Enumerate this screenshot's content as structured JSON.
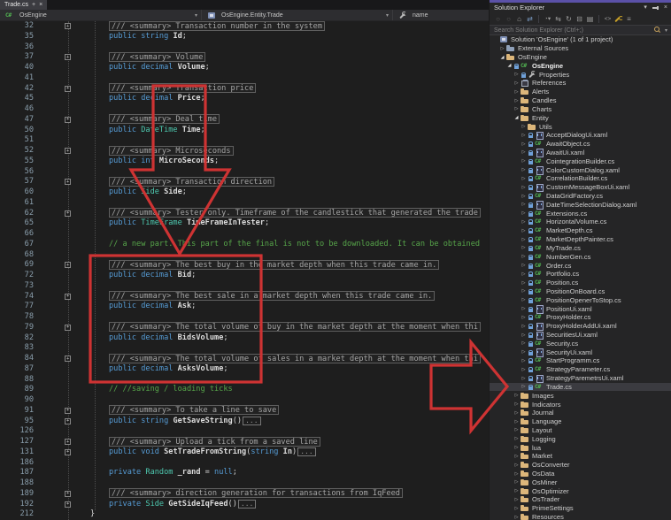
{
  "editor": {
    "tab": {
      "title": "Trade.cs"
    },
    "breadcrumb": {
      "project": "OsEngine",
      "type": "OsEngine.Entity.Trade",
      "member": "name"
    },
    "code_lines": [
      {
        "n": "32",
        "fold": 1,
        "sum": "/// <summary> Transaction number in the system"
      },
      {
        "n": "35",
        "parts": [
          [
            "public ",
            "k"
          ],
          [
            "string ",
            "k"
          ],
          [
            "Id",
            "id"
          ],
          [
            ";",
            "pl"
          ]
        ]
      },
      {
        "n": "36"
      },
      {
        "n": "37",
        "fold": 1,
        "sum": "/// <summary> Volume"
      },
      {
        "n": "40",
        "parts": [
          [
            "public ",
            "k"
          ],
          [
            "decimal ",
            "k"
          ],
          [
            "Volume",
            "id"
          ],
          [
            ";",
            "pl"
          ]
        ]
      },
      {
        "n": "41"
      },
      {
        "n": "42",
        "fold": 1,
        "sum": "/// <summary> Transaction price"
      },
      {
        "n": "45",
        "parts": [
          [
            "public ",
            "k"
          ],
          [
            "decimal ",
            "k"
          ],
          [
            "Price",
            "id"
          ],
          [
            ";",
            "pl"
          ]
        ]
      },
      {
        "n": "46"
      },
      {
        "n": "47",
        "fold": 1,
        "sum": "/// <summary> Deal time"
      },
      {
        "n": "50",
        "parts": [
          [
            "public ",
            "k"
          ],
          [
            "DateTime ",
            "t"
          ],
          [
            "Time",
            "id"
          ],
          [
            ";",
            "pl"
          ]
        ]
      },
      {
        "n": "51"
      },
      {
        "n": "52",
        "fold": 1,
        "sum": "/// <summary> Microseconds"
      },
      {
        "n": "55",
        "parts": [
          [
            "public ",
            "k"
          ],
          [
            "int ",
            "k"
          ],
          [
            "MicroSeconds",
            "id"
          ],
          [
            ";",
            "pl"
          ]
        ]
      },
      {
        "n": "56"
      },
      {
        "n": "57",
        "fold": 1,
        "sum": "/// <summary> Transaction direction"
      },
      {
        "n": "60",
        "parts": [
          [
            "public ",
            "k"
          ],
          [
            "Side ",
            "t"
          ],
          [
            "Side",
            "id"
          ],
          [
            ";",
            "pl"
          ]
        ]
      },
      {
        "n": "61"
      },
      {
        "n": "62",
        "fold": 1,
        "sum": "/// <summary> Tester only. Timeframe of the candlestick that generated the trade"
      },
      {
        "n": "65",
        "parts": [
          [
            "public ",
            "k"
          ],
          [
            "TimeFrame ",
            "t"
          ],
          [
            "TimeFrameInTester",
            "id"
          ],
          [
            ";",
            "pl"
          ]
        ]
      },
      {
        "n": "66"
      },
      {
        "n": "67",
        "parts": [
          [
            "// a new part. This part of the final is not to be downloaded. It can be obtained",
            "cm"
          ]
        ]
      },
      {
        "n": "68"
      },
      {
        "n": "69",
        "fold": 1,
        "sum": "/// <summary> The best buy in the market depth when this trade came in."
      },
      {
        "n": "72",
        "parts": [
          [
            "public ",
            "k"
          ],
          [
            "decimal ",
            "k"
          ],
          [
            "Bid",
            "id"
          ],
          [
            ";",
            "pl"
          ]
        ]
      },
      {
        "n": "73"
      },
      {
        "n": "74",
        "fold": 1,
        "sum": "/// <summary> The best sale in a market depth when this trade came in."
      },
      {
        "n": "77",
        "parts": [
          [
            "public ",
            "k"
          ],
          [
            "decimal ",
            "k"
          ],
          [
            "Ask",
            "id"
          ],
          [
            ";",
            "pl"
          ]
        ]
      },
      {
        "n": "78"
      },
      {
        "n": "79",
        "fold": 1,
        "sum": "/// <summary> The total volume of buy in the market depth at the moment when thi"
      },
      {
        "n": "82",
        "parts": [
          [
            "public ",
            "k"
          ],
          [
            "decimal ",
            "k"
          ],
          [
            "BidsVolume",
            "id"
          ],
          [
            ";",
            "pl"
          ]
        ]
      },
      {
        "n": "83"
      },
      {
        "n": "84",
        "fold": 1,
        "sum": "/// <summary> The total volume of sales in a market depth at the moment when thi"
      },
      {
        "n": "87",
        "parts": [
          [
            "public ",
            "k"
          ],
          [
            "decimal ",
            "k"
          ],
          [
            "AsksVolume",
            "id"
          ],
          [
            ";",
            "pl"
          ]
        ]
      },
      {
        "n": "88"
      },
      {
        "n": "89",
        "parts": [
          [
            "// //saving / loading ticks",
            "cm"
          ]
        ]
      },
      {
        "n": "90"
      },
      {
        "n": "91",
        "fold": 1,
        "sum": "/// <summary> To take a line to save"
      },
      {
        "n": "95",
        "fold": 1,
        "parts": [
          [
            "public ",
            "k"
          ],
          [
            "string ",
            "k"
          ],
          [
            "GetSaveString",
            "id"
          ],
          [
            "()",
            "pl"
          ],
          [
            "...",
            "ell"
          ]
        ]
      },
      {
        "n": "126"
      },
      {
        "n": "127",
        "fold": 1,
        "sum": "/// <summary> Upload a tick from a saved line"
      },
      {
        "n": "131",
        "fold": 1,
        "parts": [
          [
            "public ",
            "k"
          ],
          [
            "void ",
            "k"
          ],
          [
            "SetTradeFromString",
            "id"
          ],
          [
            "(",
            "pl"
          ],
          [
            "string ",
            "k"
          ],
          [
            "In",
            "id"
          ],
          [
            ")",
            "pl"
          ],
          [
            "...",
            "ell"
          ]
        ]
      },
      {
        "n": "186"
      },
      {
        "n": "187",
        "parts": [
          [
            "private ",
            "k"
          ],
          [
            "Random ",
            "t"
          ],
          [
            "_rand",
            "id"
          ],
          [
            " = ",
            "pl"
          ],
          [
            "null",
            "k"
          ],
          [
            ";",
            "pl"
          ]
        ]
      },
      {
        "n": "188"
      },
      {
        "n": "189",
        "fold": 1,
        "sum": "/// <summary> direction generation for transactions from IqFeed"
      },
      {
        "n": "192",
        "fold": 1,
        "parts": [
          [
            "private ",
            "k"
          ],
          [
            "Side ",
            "t"
          ],
          [
            "GetSideIqFeed",
            "id"
          ],
          [
            "()",
            "pl"
          ],
          [
            "...",
            "ell"
          ]
        ]
      },
      {
        "n": "212",
        "ind": 0,
        "parts": [
          [
            "}",
            "pl"
          ]
        ]
      }
    ]
  },
  "solution_explorer": {
    "title": "Solution Explorer",
    "search_placeholder": "Search Solution Explorer (Ctrl+;)",
    "toolbar": [
      {
        "name": "navigate-back",
        "glyph": "○",
        "cls": "dim"
      },
      {
        "name": "navigate-forward",
        "glyph": "○",
        "cls": "dim"
      },
      {
        "name": "home",
        "glyph": "⌂",
        "cls": ""
      },
      {
        "name": "sync-with-active-document",
        "glyph": "⇄",
        "cls": "blue"
      },
      {
        "name": "sep"
      },
      {
        "name": "pending-changes-filter",
        "glyph": "◔▾",
        "cls": "small"
      },
      {
        "name": "switch-views",
        "glyph": "⇆",
        "cls": ""
      },
      {
        "name": "refresh",
        "glyph": "↻",
        "cls": ""
      },
      {
        "name": "collapse-all",
        "glyph": "⊟",
        "cls": ""
      },
      {
        "name": "show-all-files",
        "glyph": "▤",
        "cls": ""
      },
      {
        "name": "sep"
      },
      {
        "name": "view-code",
        "glyph": "<>",
        "cls": "small"
      },
      {
        "name": "properties",
        "glyph": "",
        "cls": "wrench-gold"
      },
      {
        "name": "preview-selected-items",
        "glyph": "≡",
        "cls": ""
      }
    ],
    "tree": [
      {
        "label": "Solution 'OsEngine' (1 of 1 project)",
        "level": 0,
        "exp": "",
        "icon": "sln"
      },
      {
        "label": "External Sources",
        "level": 1,
        "exp": "c",
        "icon": "ext"
      },
      {
        "label": "OsEngine",
        "level": 1,
        "exp": "e",
        "icon": "folder"
      },
      {
        "label": "OsEngine",
        "level": 2,
        "exp": "e",
        "icon": "cs",
        "lock": 1,
        "bold": 1
      },
      {
        "label": "Properties",
        "level": 3,
        "exp": "c",
        "icon": "wrench",
        "lock": 1
      },
      {
        "label": "References",
        "level": 3,
        "exp": "c",
        "icon": "ref"
      },
      {
        "label": "Alerts",
        "level": 3,
        "exp": "c",
        "icon": "folder"
      },
      {
        "label": "Candles",
        "level": 3,
        "exp": "c",
        "icon": "folder"
      },
      {
        "label": "Charts",
        "level": 3,
        "exp": "c",
        "icon": "folder"
      },
      {
        "label": "Entity",
        "level": 3,
        "exp": "e",
        "icon": "folder"
      },
      {
        "label": "Utils",
        "level": 4,
        "exp": "c",
        "icon": "folder"
      },
      {
        "label": "AcceptDialogUi.xaml",
        "level": 4,
        "exp": "c",
        "icon": "xaml",
        "lock": 1
      },
      {
        "label": "AwaitObject.cs",
        "level": 4,
        "exp": "c",
        "icon": "cs",
        "lock": 1
      },
      {
        "label": "AwaitUi.xaml",
        "level": 4,
        "exp": "c",
        "icon": "xaml",
        "lock": 1
      },
      {
        "label": "CointegrationBuilder.cs",
        "level": 4,
        "exp": "c",
        "icon": "cs",
        "lock": 1
      },
      {
        "label": "ColorCustomDialog.xaml",
        "level": 4,
        "exp": "c",
        "icon": "xaml",
        "lock": 1
      },
      {
        "label": "CorrelationBuilder.cs",
        "level": 4,
        "exp": "c",
        "icon": "cs",
        "lock": 1
      },
      {
        "label": "CustomMessageBoxUi.xaml",
        "level": 4,
        "exp": "c",
        "icon": "xaml",
        "lock": 1
      },
      {
        "label": "DataGridFactory.cs",
        "level": 4,
        "exp": "c",
        "icon": "cs",
        "lock": 1
      },
      {
        "label": "DateTimeSelectionDialog.xaml",
        "level": 4,
        "exp": "c",
        "icon": "xaml",
        "lock": 1
      },
      {
        "label": "Extensions.cs",
        "level": 4,
        "exp": "c",
        "icon": "cs",
        "lock": 1
      },
      {
        "label": "HorizontalVolume.cs",
        "level": 4,
        "exp": "c",
        "icon": "cs",
        "lock": 1
      },
      {
        "label": "MarketDepth.cs",
        "level": 4,
        "exp": "c",
        "icon": "cs",
        "lock": 1
      },
      {
        "label": "MarketDepthPainter.cs",
        "level": 4,
        "exp": "c",
        "icon": "cs",
        "lock": 1
      },
      {
        "label": "MyTrade.cs",
        "level": 4,
        "exp": "c",
        "icon": "cs",
        "lock": 1
      },
      {
        "label": "NumberGen.cs",
        "level": 4,
        "exp": "c",
        "icon": "cs",
        "lock": 1
      },
      {
        "label": "Order.cs",
        "level": 4,
        "exp": "c",
        "icon": "cs",
        "lock": 1
      },
      {
        "label": "Portfolio.cs",
        "level": 4,
        "exp": "c",
        "icon": "cs",
        "lock": 1
      },
      {
        "label": "Position.cs",
        "level": 4,
        "exp": "c",
        "icon": "cs",
        "lock": 1
      },
      {
        "label": "PositionOnBoard.cs",
        "level": 4,
        "exp": "c",
        "icon": "cs",
        "lock": 1
      },
      {
        "label": "PositionOpenerToStop.cs",
        "level": 4,
        "exp": "c",
        "icon": "cs",
        "lock": 1
      },
      {
        "label": "PositionUi.xaml",
        "level": 4,
        "exp": "c",
        "icon": "xaml",
        "lock": 1
      },
      {
        "label": "ProxyHolder.cs",
        "level": 4,
        "exp": "c",
        "icon": "cs",
        "lock": 1
      },
      {
        "label": "ProxyHolderAddUi.xaml",
        "level": 4,
        "exp": "c",
        "icon": "xaml",
        "lock": 1
      },
      {
        "label": "SecuritiesUi.xaml",
        "level": 4,
        "exp": "c",
        "icon": "xaml",
        "lock": 1
      },
      {
        "label": "Security.cs",
        "level": 4,
        "exp": "c",
        "icon": "cs",
        "lock": 1
      },
      {
        "label": "SecurityUi.xaml",
        "level": 4,
        "exp": "c",
        "icon": "xaml",
        "lock": 1
      },
      {
        "label": "StartProgramm.cs",
        "level": 4,
        "exp": "c",
        "icon": "cs",
        "lock": 1
      },
      {
        "label": "StrategyParameter.cs",
        "level": 4,
        "exp": "c",
        "icon": "cs",
        "lock": 1
      },
      {
        "label": "StrategyParemetrsUi.xaml",
        "level": 4,
        "exp": "c",
        "icon": "xaml",
        "lock": 1
      },
      {
        "label": "Trade.cs",
        "level": 4,
        "exp": "c",
        "icon": "cs",
        "lock": 1,
        "sel": 1
      },
      {
        "label": "Images",
        "level": 3,
        "exp": "c",
        "icon": "folder"
      },
      {
        "label": "Indicators",
        "level": 3,
        "exp": "c",
        "icon": "folder"
      },
      {
        "label": "Journal",
        "level": 3,
        "exp": "c",
        "icon": "folder"
      },
      {
        "label": "Language",
        "level": 3,
        "exp": "c",
        "icon": "folder"
      },
      {
        "label": "Layout",
        "level": 3,
        "exp": "c",
        "icon": "folder"
      },
      {
        "label": "Logging",
        "level": 3,
        "exp": "c",
        "icon": "folder"
      },
      {
        "label": "lua",
        "level": 3,
        "exp": "c",
        "icon": "folder"
      },
      {
        "label": "Market",
        "level": 3,
        "exp": "c",
        "icon": "folder"
      },
      {
        "label": "OsConverter",
        "level": 3,
        "exp": "c",
        "icon": "folder"
      },
      {
        "label": "OsData",
        "level": 3,
        "exp": "c",
        "icon": "folder"
      },
      {
        "label": "OsMiner",
        "level": 3,
        "exp": "c",
        "icon": "folder"
      },
      {
        "label": "OsOptimizer",
        "level": 3,
        "exp": "c",
        "icon": "folder"
      },
      {
        "label": "OsTrader",
        "level": 3,
        "exp": "c",
        "icon": "folder"
      },
      {
        "label": "PrimeSettings",
        "level": 3,
        "exp": "c",
        "icon": "folder"
      },
      {
        "label": "Resources",
        "level": 3,
        "exp": "c",
        "icon": "folder"
      }
    ]
  },
  "annotations": {
    "color": "#ce3333",
    "shapes": [
      "down-arrow-over-fields",
      "highlight-box-bid-ask-volumes",
      "right-arrow-to-trade-cs"
    ]
  },
  "colors": {
    "editor_bg": "#1e1e1e",
    "panel_bg": "#252526",
    "accent_strip": "#5b51a8",
    "keyword": "#569cd6",
    "type": "#4ec9b0",
    "comment": "#57a64a",
    "selection_row": "#3b3b40"
  }
}
